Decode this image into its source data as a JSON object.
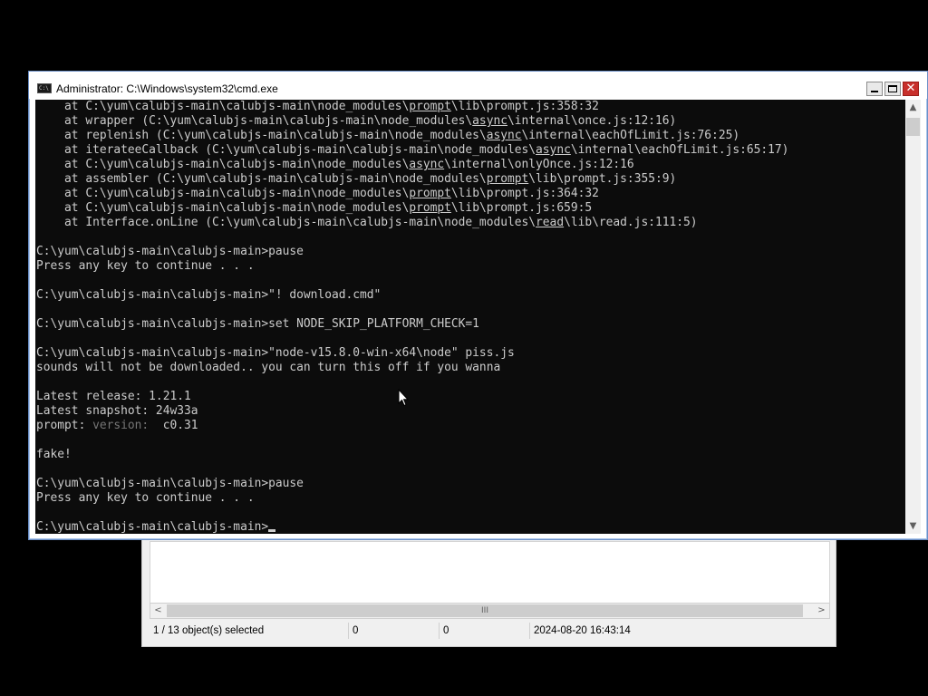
{
  "explorer": {
    "status_selected": "1 / 13 object(s) selected",
    "status_col2": "0",
    "status_col3": "0",
    "status_date": "2024-08-20 16:43:14",
    "scroll_left_glyph": "<",
    "scroll_right_glyph": ">",
    "scroll_grip_glyph": "III"
  },
  "cmd": {
    "title": "Administrator: C:\\Windows\\system32\\cmd.exe",
    "icon_label": "C:\\",
    "close_glyph": "✕",
    "scroll_up_glyph": "▲",
    "scroll_down_glyph": "▼",
    "lines": [
      {
        "segments": [
          {
            "t": "    at C:\\yum\\calubjs-main\\calubjs-main\\node_modules\\"
          },
          {
            "t": "prompt",
            "u": true
          },
          {
            "t": "\\lib\\prompt.js:358:32"
          }
        ]
      },
      {
        "segments": [
          {
            "t": "    at wrapper (C:\\yum\\calubjs-main\\calubjs-main\\node_modules\\"
          },
          {
            "t": "async",
            "u": true
          },
          {
            "t": "\\internal\\once.js:12:16)"
          }
        ]
      },
      {
        "segments": [
          {
            "t": "    at replenish (C:\\yum\\calubjs-main\\calubjs-main\\node_modules\\"
          },
          {
            "t": "async",
            "u": true
          },
          {
            "t": "\\internal\\eachOfLimit.js:76:25)"
          }
        ]
      },
      {
        "segments": [
          {
            "t": "    at iterateeCallback (C:\\yum\\calubjs-main\\calubjs-main\\node_modules\\"
          },
          {
            "t": "async",
            "u": true
          },
          {
            "t": "\\internal\\eachOfLimit.js:65:17)"
          }
        ]
      },
      {
        "segments": [
          {
            "t": "    at C:\\yum\\calubjs-main\\calubjs-main\\node_modules\\"
          },
          {
            "t": "async",
            "u": true
          },
          {
            "t": "\\internal\\onlyOnce.js:12:16"
          }
        ]
      },
      {
        "segments": [
          {
            "t": "    at assembler (C:\\yum\\calubjs-main\\calubjs-main\\node_modules\\"
          },
          {
            "t": "prompt",
            "u": true
          },
          {
            "t": "\\lib\\prompt.js:355:9)"
          }
        ]
      },
      {
        "segments": [
          {
            "t": "    at C:\\yum\\calubjs-main\\calubjs-main\\node_modules\\"
          },
          {
            "t": "prompt",
            "u": true
          },
          {
            "t": "\\lib\\prompt.js:364:32"
          }
        ]
      },
      {
        "segments": [
          {
            "t": "    at C:\\yum\\calubjs-main\\calubjs-main\\node_modules\\"
          },
          {
            "t": "prompt",
            "u": true
          },
          {
            "t": "\\lib\\prompt.js:659:5"
          }
        ]
      },
      {
        "segments": [
          {
            "t": "    at Interface.onLine (C:\\yum\\calubjs-main\\calubjs-main\\node_modules\\"
          },
          {
            "t": "read",
            "u": true
          },
          {
            "t": "\\lib\\read.js:111:5)"
          }
        ]
      },
      {
        "segments": [
          {
            "t": ""
          }
        ]
      },
      {
        "segments": [
          {
            "t": "C:\\yum\\calubjs-main\\calubjs-main>pause"
          }
        ]
      },
      {
        "segments": [
          {
            "t": "Press any key to continue . . ."
          }
        ]
      },
      {
        "segments": [
          {
            "t": ""
          }
        ]
      },
      {
        "segments": [
          {
            "t": "C:\\yum\\calubjs-main\\calubjs-main>\"! download.cmd\""
          }
        ]
      },
      {
        "segments": [
          {
            "t": ""
          }
        ]
      },
      {
        "segments": [
          {
            "t": "C:\\yum\\calubjs-main\\calubjs-main>set NODE_SKIP_PLATFORM_CHECK=1"
          }
        ]
      },
      {
        "segments": [
          {
            "t": ""
          }
        ]
      },
      {
        "segments": [
          {
            "t": "C:\\yum\\calubjs-main\\calubjs-main>\"node-v15.8.0-win-x64\\node\" piss.js"
          }
        ]
      },
      {
        "segments": [
          {
            "t": "sounds will not be downloaded.. you can turn this off if you wanna"
          }
        ]
      },
      {
        "segments": [
          {
            "t": ""
          }
        ]
      },
      {
        "segments": [
          {
            "t": "Latest release: 1.21.1"
          }
        ]
      },
      {
        "segments": [
          {
            "t": "Latest snapshot: 24w33a"
          }
        ]
      },
      {
        "segments": [
          {
            "t": "prompt: "
          },
          {
            "t": "version:",
            "dim": true
          },
          {
            "t": "  c0.31"
          }
        ]
      },
      {
        "segments": [
          {
            "t": ""
          }
        ]
      },
      {
        "segments": [
          {
            "t": "fake!"
          }
        ]
      },
      {
        "segments": [
          {
            "t": ""
          }
        ]
      },
      {
        "segments": [
          {
            "t": "C:\\yum\\calubjs-main\\calubjs-main>pause"
          }
        ]
      },
      {
        "segments": [
          {
            "t": "Press any key to continue . . ."
          }
        ]
      },
      {
        "segments": [
          {
            "t": ""
          }
        ]
      },
      {
        "segments": [
          {
            "t": "C:\\yum\\calubjs-main\\calubjs-main>"
          }
        ],
        "cursor": true
      }
    ]
  },
  "colors": {
    "console_bg": "#0c0c0c",
    "console_text": "#cccccc",
    "close_button": "#c8302c"
  }
}
